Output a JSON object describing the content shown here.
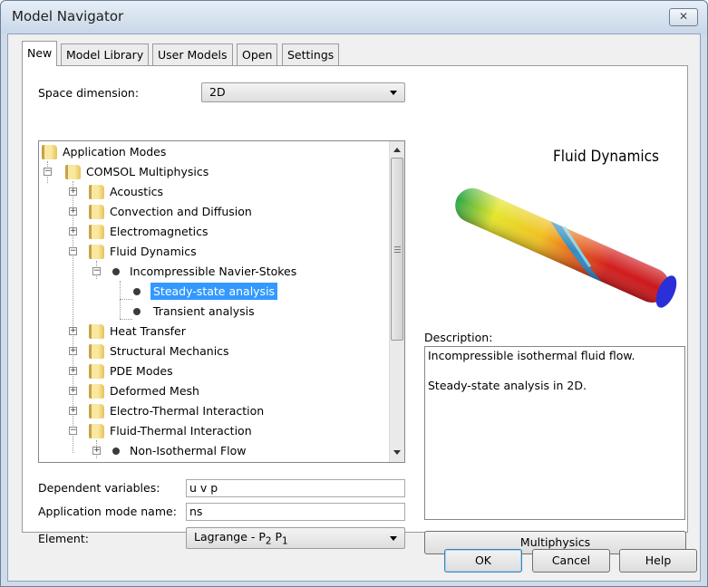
{
  "window": {
    "title": "Model Navigator",
    "close_glyph": "✕"
  },
  "tabs": [
    {
      "label": "New",
      "active": true
    },
    {
      "label": "Model Library",
      "active": false
    },
    {
      "label": "User Models",
      "active": false
    },
    {
      "label": "Open",
      "active": false
    },
    {
      "label": "Settings",
      "active": false
    }
  ],
  "space_dimension": {
    "label": "Space dimension:",
    "value": "2D"
  },
  "tree": {
    "items": [
      {
        "label": "Application Modes",
        "type": "folder",
        "expanded": true
      },
      {
        "label": "COMSOL Multiphysics",
        "type": "folder",
        "expanded": true
      },
      {
        "label": "Acoustics",
        "type": "folder",
        "expanded": false
      },
      {
        "label": "Convection and Diffusion",
        "type": "folder",
        "expanded": false
      },
      {
        "label": "Electromagnetics",
        "type": "folder",
        "expanded": false
      },
      {
        "label": "Fluid Dynamics",
        "type": "folder",
        "expanded": true
      },
      {
        "label": "Incompressible Navier-Stokes",
        "type": "mode",
        "expanded": true
      },
      {
        "label": "Steady-state analysis",
        "type": "analysis",
        "selected": true
      },
      {
        "label": "Transient analysis",
        "type": "analysis",
        "selected": false
      },
      {
        "label": "Heat Transfer",
        "type": "folder",
        "expanded": false
      },
      {
        "label": "Structural Mechanics",
        "type": "folder",
        "expanded": false
      },
      {
        "label": "PDE Modes",
        "type": "folder",
        "expanded": false
      },
      {
        "label": "Deformed Mesh",
        "type": "folder",
        "expanded": false
      },
      {
        "label": "Electro-Thermal Interaction",
        "type": "folder",
        "expanded": false
      },
      {
        "label": "Fluid-Thermal Interaction",
        "type": "folder",
        "expanded": true
      },
      {
        "label": "Non-Isothermal Flow",
        "type": "mode",
        "expanded": false
      }
    ]
  },
  "preview": {
    "title": "Fluid Dynamics",
    "icon": "fluid-flow-pipe-image"
  },
  "description": {
    "label": "Description:",
    "line1": "Incompressible isothermal fluid flow.",
    "line2": "Steady-state analysis in 2D."
  },
  "dependent_variables": {
    "label": "Dependent variables:",
    "value": "u v p"
  },
  "app_mode_name": {
    "label": "Application mode name:",
    "value": "ns"
  },
  "element": {
    "label": "Element:",
    "value_main": "Lagrange - P",
    "sub1": "2",
    "mid": " P",
    "sub2": "1"
  },
  "buttons": {
    "multiphysics": "Multiphysics",
    "ok": "OK",
    "cancel": "Cancel",
    "help": "Help"
  },
  "colors": {
    "selection": "#3399ff",
    "titlebar": "#cfdbe9",
    "default_button_border": "#3c7fb1"
  }
}
